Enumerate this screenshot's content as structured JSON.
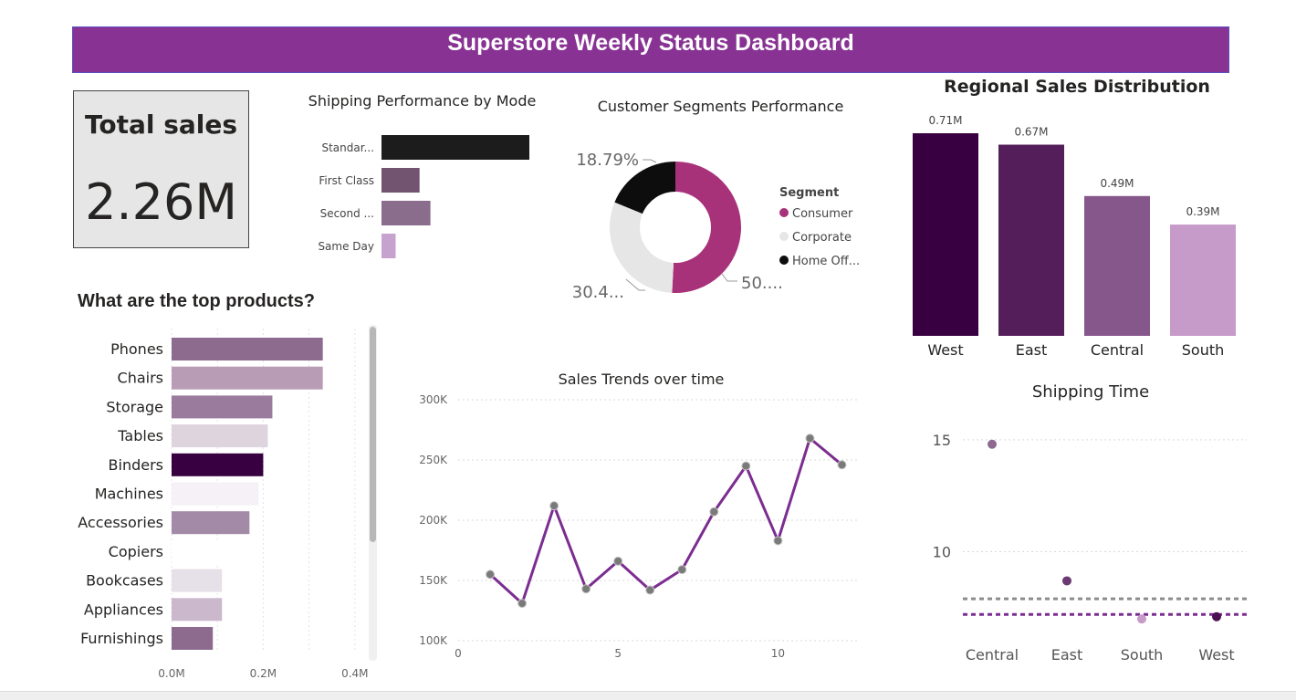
{
  "dashboard": {
    "title": "Superstore Weekly Status Dashboard",
    "kpi": {
      "label": "Total sales",
      "value": "2.26M"
    }
  },
  "colors": {
    "title_bar": "#883394",
    "accent": "#a83279",
    "line": "#7b2d90"
  },
  "chart_data": [
    {
      "id": "shipping_mode",
      "type": "bar",
      "orientation": "horizontal",
      "title": "Shipping Performance by Mode",
      "categories": [
        "Standar...",
        "First Class",
        "Second ...",
        "Same Day"
      ],
      "values": [
        1.36,
        0.35,
        0.45,
        0.13
      ],
      "bar_colors": [
        "#1c1c1c",
        "#735470",
        "#8a6c8d",
        "#c6a3cf"
      ]
    },
    {
      "id": "segments",
      "type": "pie",
      "variant": "donut",
      "title": "Customer Segments Performance",
      "legend_title": "Segment",
      "legend_position": "right",
      "labels": [
        "Consumer",
        "Corporate",
        "Home Off..."
      ],
      "values": [
        50.81,
        30.4,
        18.79
      ],
      "data_labels": [
        "50....",
        "30.4...",
        "18.79%"
      ],
      "slice_colors": [
        "#a83279",
        "#e6e6e6",
        "#0d0d0d"
      ]
    },
    {
      "id": "regional_sales",
      "type": "bar",
      "title": "Regional Sales Distribution",
      "categories": [
        "West",
        "East",
        "Central",
        "South"
      ],
      "values": [
        0.71,
        0.67,
        0.49,
        0.39
      ],
      "data_labels": [
        "0.71M",
        "0.67M",
        "0.49M",
        "0.39M"
      ],
      "bar_colors": [
        "#380040",
        "#541e5a",
        "#85578a",
        "#c69ac9"
      ]
    },
    {
      "id": "top_products",
      "type": "bar",
      "orientation": "horizontal",
      "title": "What are the top products?",
      "categories": [
        "Phones",
        "Chairs",
        "Storage",
        "Tables",
        "Binders",
        "Machines",
        "Accessories",
        "Copiers",
        "Bookcases",
        "Appliances",
        "Furnishings"
      ],
      "values": [
        0.33,
        0.33,
        0.22,
        0.21,
        0.2,
        0.19,
        0.17,
        0.15,
        0.11,
        0.11,
        0.09
      ],
      "bar_colors": [
        "#8c6b8e",
        "#b89cb6",
        "#9a7b9d",
        "#ddd4de",
        "#380040",
        "#f5f1f6",
        "#a38aa7",
        "#ffffff",
        "#e6e0e8",
        "#cbb8cd",
        "#8c6b8e"
      ],
      "xticks": [
        "0.0M",
        "0.2M",
        "0.4M"
      ],
      "xlim": [
        0,
        0.4
      ]
    },
    {
      "id": "sales_trend",
      "type": "line",
      "title": "Sales Trends over time",
      "x": [
        1,
        2,
        3,
        4,
        5,
        6,
        7,
        8,
        9,
        10,
        11,
        12
      ],
      "values": [
        155000,
        131000,
        212000,
        143000,
        166000,
        142000,
        159000,
        207000,
        245000,
        183000,
        268000,
        246000
      ],
      "xticks": [
        "0",
        "5",
        "10"
      ],
      "yticks": [
        "100K",
        "150K",
        "200K",
        "250K",
        "300K"
      ],
      "xlim": [
        0,
        12.5
      ],
      "ylim": [
        100000,
        300000
      ],
      "grid": true
    },
    {
      "id": "shipping_time",
      "type": "scatter",
      "title": "Shipping Time",
      "categories": [
        "Central",
        "East",
        "South",
        "West"
      ],
      "values": [
        14.8,
        8.7,
        7.0,
        7.1
      ],
      "point_colors": [
        "#8c6b8e",
        "#6b3a72",
        "#c69ac9",
        "#4a1050"
      ],
      "yticks": [
        "10",
        "15"
      ],
      "ylim": [
        5.5,
        16.5
      ],
      "reference_lines": [
        {
          "value": 7.9,
          "color": "#8c8c8c"
        },
        {
          "value": 7.2,
          "color": "#7b2d90"
        }
      ],
      "grid": true
    }
  ]
}
